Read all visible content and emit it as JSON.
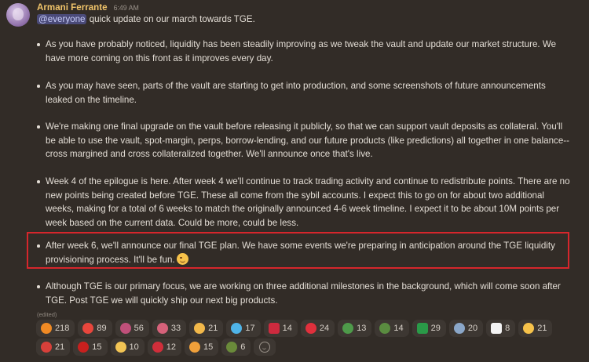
{
  "message": {
    "author": "Armani Ferrante",
    "timestamp": "6:49 AM",
    "mention": "@everyone",
    "intro": " quick update on our march towards TGE.",
    "bullets": [
      "As you have probably noticed, liquidity has been steadily improving as we tweak the vault and update our market structure. We have more coming on this front as it improves every day.",
      "As you may have seen, parts of the vault are starting to get into production, and some screenshots of future announcements leaked on the timeline.",
      "We're making one final upgrade on the vault before releasing it publicly, so that we can support vault deposits as collateral. You'll be able to use the vault, spot-margin, perps, borrow-lending, and our future products (like predictions) all together in one balance--cross margined and cross collateralized together. We'll announce once that's live.",
      "Week 4 of the epilogue is here. After week 4 we'll continue to track trading activity and continue to redistribute points. There are no new points being created before TGE. These all come from the sybil accounts. I expect this to go on for about two additional weeks, making for a total of 6 weeks to match the originally announced 4-6 week timeline. I expect it to be about 10M points per week based on the current data. Could be more, could be less.",
      "After week 6, we'll announce our final TGE plan. We have some events we're preparing in anticipation around the TGE liquidity provisioning process. It'll be fun.",
      "Although TGE is our primary focus, we are working on three additional milestones in the background, which will come soon after TGE. Post TGE we will quickly ship our next big products."
    ],
    "edited_label": "(edited)"
  },
  "reactions": {
    "row1": [
      {
        "icon": "fire-icon",
        "count": "218",
        "color": "#f08a24"
      },
      {
        "icon": "muscle-icon",
        "count": "89",
        "color": "#e8463c"
      },
      {
        "icon": "camera-icon",
        "count": "56",
        "color": "#c0507a"
      },
      {
        "icon": "gift-icon",
        "count": "33",
        "color": "#d6627a"
      },
      {
        "icon": "handshake-icon",
        "count": "21",
        "color": "#f2b84a"
      },
      {
        "icon": "gem-icon",
        "count": "17",
        "color": "#4fb4e8"
      },
      {
        "icon": "hungary-flag-icon",
        "count": "14",
        "color": "#cd2a3e"
      },
      {
        "icon": "heart-icon",
        "count": "24",
        "color": "#e0303c"
      },
      {
        "icon": "frog-icon",
        "count": "13",
        "color": "#4e9a4a"
      },
      {
        "icon": "frog-dance-icon",
        "count": "14",
        "color": "#5a8c40"
      },
      {
        "icon": "brazil-flag-icon",
        "count": "29",
        "color": "#2a9a48"
      },
      {
        "icon": "doll-icon",
        "count": "20",
        "color": "#8aa6c8"
      },
      {
        "icon": "korea-flag-icon",
        "count": "8",
        "color": "#f4f4f4"
      },
      {
        "icon": "sad-relieved-icon",
        "count": "21",
        "color": "#f6c24a"
      }
    ],
    "row2": [
      {
        "icon": "robot-icon",
        "count": "21",
        "color": "#d8403a"
      },
      {
        "icon": "ninja-badge-icon",
        "count": "15",
        "color": "#c8201e"
      },
      {
        "icon": "pray-icon",
        "count": "10",
        "color": "#f2c454"
      },
      {
        "icon": "ribbon-gift-icon",
        "count": "12",
        "color": "#d02e3a"
      },
      {
        "icon": "party-popper-icon",
        "count": "15",
        "color": "#f0a03a"
      },
      {
        "icon": "pepe-icon",
        "count": "6",
        "color": "#6a8a3a"
      }
    ]
  }
}
